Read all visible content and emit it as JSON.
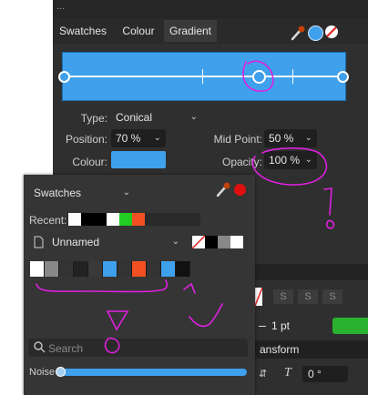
{
  "header": {
    "clipped_text": "..."
  },
  "tabs": [
    {
      "label": "Swatches"
    },
    {
      "label": "Colour"
    },
    {
      "label": "Gradient"
    }
  ],
  "gradient": {
    "type_label": "Type:",
    "type_value": "Conical",
    "position_label": "Position:",
    "position_value": "70 %",
    "mid_point_label": "Mid Point:",
    "mid_point_value": "50 %",
    "colour_label": "Colour:",
    "opacity_label": "Opacity:",
    "opacity_value": "100 %",
    "bar_color": "#3fa0ec"
  },
  "swatches_panel": {
    "title": "Swatches",
    "recent_label": "Recent:",
    "recent_colors": [
      "#ffffff",
      "#000000",
      "#000000",
      "#ffffff",
      "#22cc22",
      "#f25022"
    ],
    "palette_name": "Unnamed",
    "palette_colors": [
      "#ffffff",
      "#888888",
      "#333333",
      "#222222",
      "#3a3a3a",
      "#3fa0ec",
      "#333333",
      "#f25022",
      "#333333",
      "#3fa0ec",
      "#111111"
    ],
    "search_placeholder": "Search",
    "noise_label": "Noise"
  },
  "right_panel": {
    "stroke_width": "1 pt",
    "transform_label": "ansform",
    "rotation_value": "0 °"
  },
  "accent_color": "#3fa0ec",
  "annotation_color": "#e020e0"
}
